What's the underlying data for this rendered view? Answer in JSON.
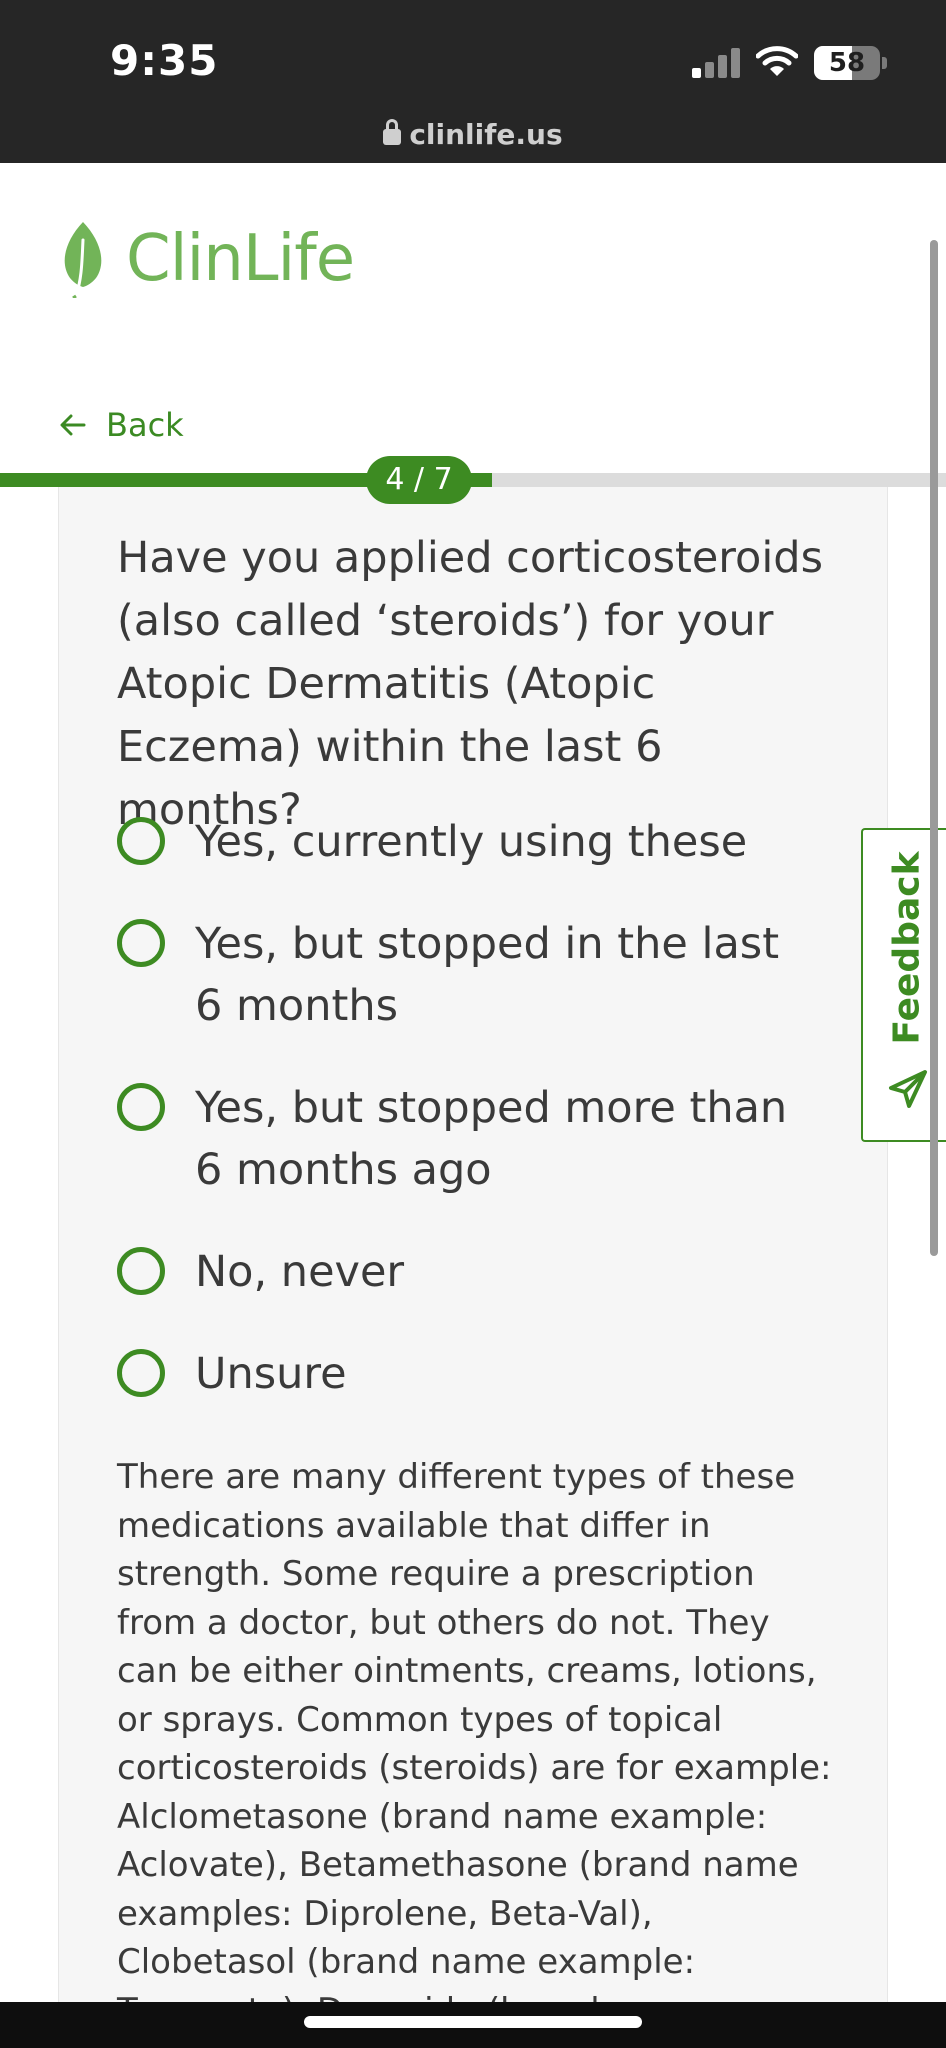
{
  "status_bar": {
    "time": "9:35",
    "battery": "58",
    "battery_level": 0.58,
    "url": "clinlife.us"
  },
  "header": {
    "logo_text": "ClinLife",
    "back_label": "Back"
  },
  "progress": {
    "label": "4 / 7",
    "fraction": 0.52
  },
  "question": {
    "text": "Have you applied corticosteroids (also called ‘steroids’) for your Atopic Dermatitis (Atopic Eczema) within the last 6 months?",
    "options": [
      {
        "label": "Yes, currently using these"
      },
      {
        "label": "Yes, but stopped in the last 6 months"
      },
      {
        "label": "Yes, but stopped more than 6 months ago"
      },
      {
        "label": "No, never"
      },
      {
        "label": "Unsure"
      }
    ],
    "info": "There are many different types of these medications available that differ in strength. Some require a prescription from a doctor, but others do not. They can be either ointments, creams, lotions, or sprays. Common types of topical corticosteroids (steroids) are for example: Alclometasone (brand name example: Aclovate), Betamethasone (brand name examples: Diprolene, Beta-Val), Clobetasol (brand name example: Temovate), Desonide (brand name example: Desonate),"
  },
  "feedback": {
    "label": "Feedback"
  },
  "colors": {
    "brand_green": "#3d8b22",
    "logo_green": "#72b458",
    "card_background": "#f6f6f6"
  }
}
